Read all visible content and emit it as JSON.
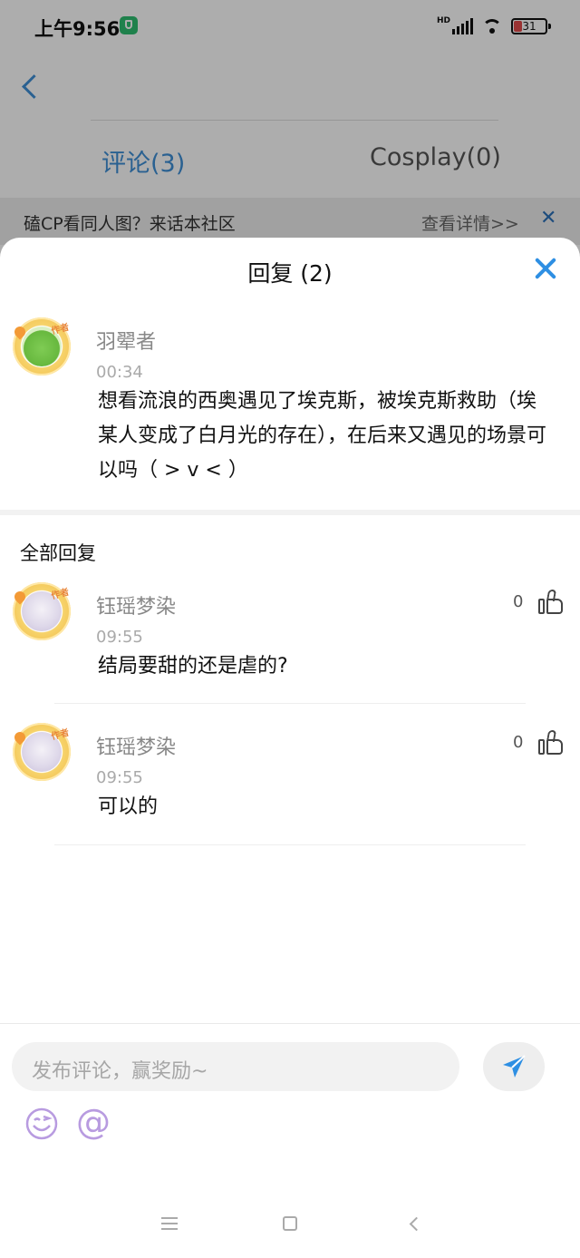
{
  "status_bar": {
    "time": "上午9:56",
    "network": "HD",
    "battery": "31"
  },
  "background_page": {
    "tabs": [
      {
        "label": "评论(3)",
        "active": true
      },
      {
        "label": "Cosplay(0)",
        "active": false
      }
    ],
    "banner": {
      "text": "磕CP看同人图？来话本社区",
      "link": "查看详情>>"
    }
  },
  "sheet": {
    "title": "回复 (2)",
    "original_comment": {
      "author": "羽翚者",
      "author_badge": "作者",
      "time": "00:34",
      "content": "想看流浪的西奥遇见了埃克斯，被埃克斯救助（埃某人变成了白月光的存在），在后来又遇见的场景可以吗（ > v < ）"
    },
    "section_title": "全部回复",
    "replies": [
      {
        "author": "钰瑶梦染",
        "author_badge": "作者",
        "time": "09:55",
        "content": "结局要甜的还是虐的?",
        "likes": "0"
      },
      {
        "author": "钰瑶梦染",
        "author_badge": "作者",
        "time": "09:55",
        "content": "可以的",
        "likes": "0"
      }
    ]
  },
  "input_bar": {
    "placeholder": "发布评论，赢奖励~"
  },
  "colors": {
    "accent": "#2e8fe3",
    "tab_active": "#3f8fd6",
    "emoji_icon": "#b89be0"
  },
  "icons": [
    "back-icon",
    "close-icon",
    "like-icon",
    "send-icon",
    "emoji-icon",
    "at-icon",
    "menu-icon",
    "home-icon",
    "nav-back-icon"
  ]
}
